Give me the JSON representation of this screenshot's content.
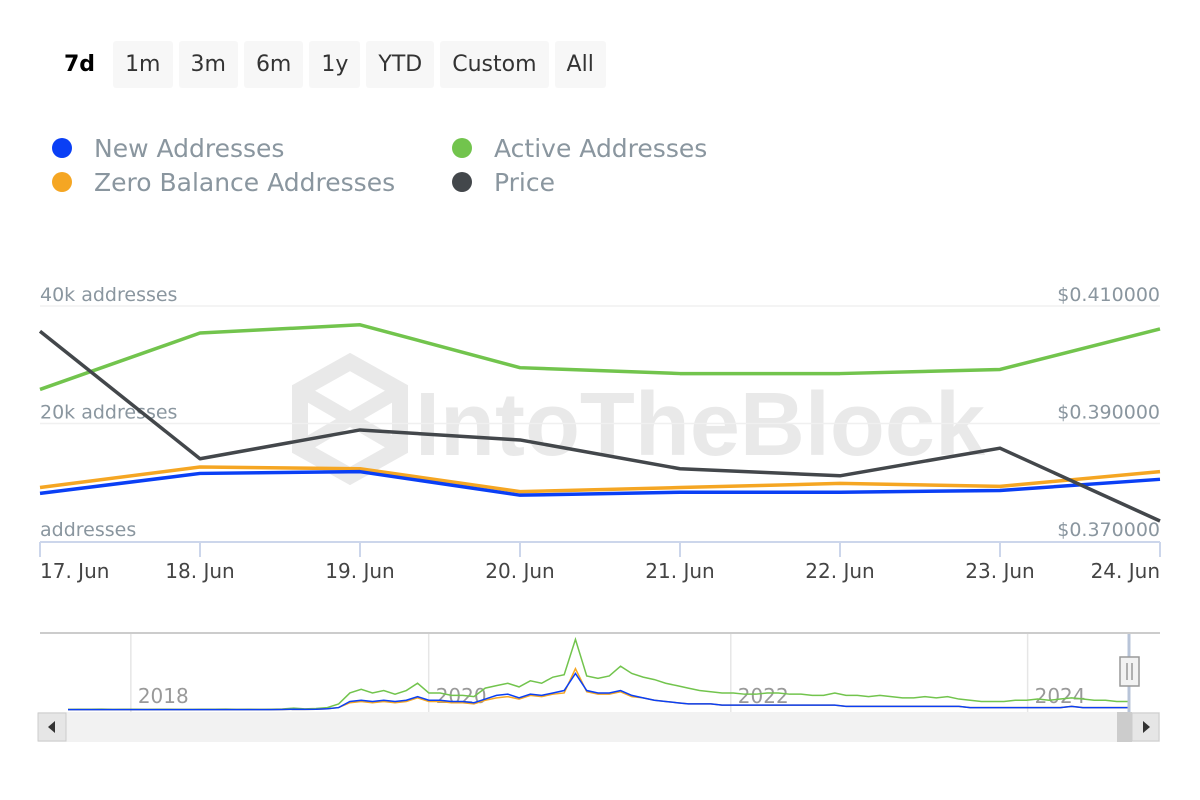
{
  "range_selector": {
    "buttons": [
      {
        "label": "7d",
        "active": true
      },
      {
        "label": "1m",
        "active": false
      },
      {
        "label": "3m",
        "active": false
      },
      {
        "label": "6m",
        "active": false
      },
      {
        "label": "1y",
        "active": false
      },
      {
        "label": "YTD",
        "active": false
      },
      {
        "label": "Custom",
        "active": false
      },
      {
        "label": "All",
        "active": false
      }
    ]
  },
  "legend": [
    {
      "label": "New Addresses",
      "color": "#0a3ff5"
    },
    {
      "label": "Active Addresses",
      "color": "#72c44d"
    },
    {
      "label": "Zero Balance Addresses",
      "color": "#f5a623"
    },
    {
      "label": "Price",
      "color": "#43474b"
    }
  ],
  "watermark": "IntoTheBlock",
  "chart_data": {
    "type": "line",
    "title": "",
    "x": [
      "17. Jun",
      "18. Jun",
      "19. Jun",
      "20. Jun",
      "21. Jun",
      "22. Jun",
      "23. Jun",
      "24. Jun"
    ],
    "left_axis": {
      "ticks": [
        0,
        20000,
        40000
      ],
      "tick_labels": [
        "addresses",
        "20k addresses",
        "40k addresses"
      ],
      "ylim": [
        0,
        40000
      ]
    },
    "right_axis": {
      "ticks": [
        0.37,
        0.39,
        0.41
      ],
      "tick_labels": [
        "$0.370000",
        "$0.390000",
        "$0.410000"
      ],
      "ylim": [
        0.37,
        0.41
      ]
    },
    "series": [
      {
        "name": "Active Addresses",
        "axis": "left",
        "color": "#72c44d",
        "values": [
          25800,
          35400,
          36800,
          29500,
          28500,
          28500,
          29200,
          36100
        ]
      },
      {
        "name": "Zero Balance Addresses",
        "axis": "left",
        "color": "#f5a623",
        "values": [
          9100,
          12600,
          12300,
          8400,
          9100,
          9800,
          9300,
          11800
        ]
      },
      {
        "name": "New Addresses",
        "axis": "left",
        "color": "#0a3ff5",
        "values": [
          8100,
          11500,
          11800,
          7800,
          8300,
          8300,
          8600,
          10500
        ]
      },
      {
        "name": "Price",
        "axis": "right",
        "color": "#43474b",
        "values": [
          0.4057,
          0.384,
          0.3889,
          0.3872,
          0.3823,
          0.3811,
          0.3858,
          0.3734
        ]
      }
    ],
    "grid": true,
    "legend_position": "top-left"
  },
  "navigator": {
    "year_labels": [
      "2018",
      "2020",
      "2022",
      "2024"
    ],
    "year_positions": [
      0.064,
      0.345,
      0.63,
      0.91
    ],
    "series": [
      {
        "name": "Active Addresses",
        "color": "#72c44d",
        "values": [
          0.5,
          0.6,
          0.6,
          0.7,
          0.5,
          0.6,
          0.6,
          0.5,
          0.6,
          0.6,
          0.5,
          0.5,
          0.6,
          0.6,
          0.7,
          0.5,
          0.6,
          0.5,
          0.6,
          0.8,
          1.5,
          0.9,
          1.2,
          2,
          5,
          14,
          17,
          14,
          16,
          13,
          16,
          22,
          14,
          14,
          12,
          12,
          11,
          18,
          20,
          22,
          19,
          24,
          22,
          27,
          29,
          58,
          28,
          26,
          28,
          36,
          30,
          27,
          25,
          22,
          20,
          18,
          16,
          15,
          14,
          14,
          13,
          13,
          14,
          14,
          13,
          13,
          12,
          12,
          14,
          12,
          12,
          11,
          12,
          11,
          10,
          10,
          11,
          10,
          11,
          9,
          8,
          7,
          7,
          7,
          8,
          8,
          9,
          8,
          9,
          10,
          9,
          8,
          8,
          7,
          7
        ]
      },
      {
        "name": "Zero Balance Addresses",
        "color": "#f5a623",
        "values": [
          0.3,
          0.3,
          0.3,
          0.3,
          0.3,
          0.3,
          0.3,
          0.3,
          0.3,
          0.3,
          0.3,
          0.3,
          0.3,
          0.3,
          0.3,
          0.3,
          0.3,
          0.3,
          0.3,
          0.4,
          0.6,
          0.5,
          0.6,
          1,
          2,
          6,
          7,
          6,
          7,
          6,
          7,
          10,
          7,
          7,
          6,
          6,
          5,
          8,
          10,
          11,
          9,
          12,
          11,
          13,
          14,
          34,
          15,
          13,
          13,
          15,
          11,
          10,
          8,
          7,
          6,
          5,
          5,
          5,
          4,
          4,
          4,
          4,
          4,
          4,
          4,
          4,
          4,
          4,
          4,
          3,
          3,
          3,
          3,
          3,
          3,
          3,
          3,
          3,
          3,
          3,
          2,
          2,
          2,
          2,
          2,
          2,
          2,
          2,
          2,
          3,
          2,
          2,
          2,
          2,
          2
        ]
      },
      {
        "name": "New Addresses",
        "color": "#0a3ff5",
        "values": [
          0.3,
          0.3,
          0.3,
          0.3,
          0.3,
          0.3,
          0.3,
          0.3,
          0.3,
          0.3,
          0.3,
          0.3,
          0.3,
          0.3,
          0.3,
          0.3,
          0.3,
          0.3,
          0.3,
          0.4,
          0.6,
          0.5,
          0.6,
          1,
          2,
          7,
          8,
          7,
          8,
          7,
          8,
          11,
          8,
          8,
          7,
          7,
          6,
          9,
          12,
          13,
          10,
          13,
          12,
          14,
          16,
          30,
          16,
          14,
          14,
          16,
          12,
          10,
          8,
          7,
          6,
          5,
          5,
          5,
          4,
          4,
          4,
          4,
          4,
          4,
          4,
          4,
          4,
          4,
          4,
          3,
          3,
          3,
          3,
          3,
          3,
          3,
          3,
          3,
          3,
          3,
          2,
          2,
          2,
          2,
          2,
          2,
          2,
          2,
          2,
          3,
          2,
          2,
          2,
          2,
          2
        ]
      }
    ]
  }
}
